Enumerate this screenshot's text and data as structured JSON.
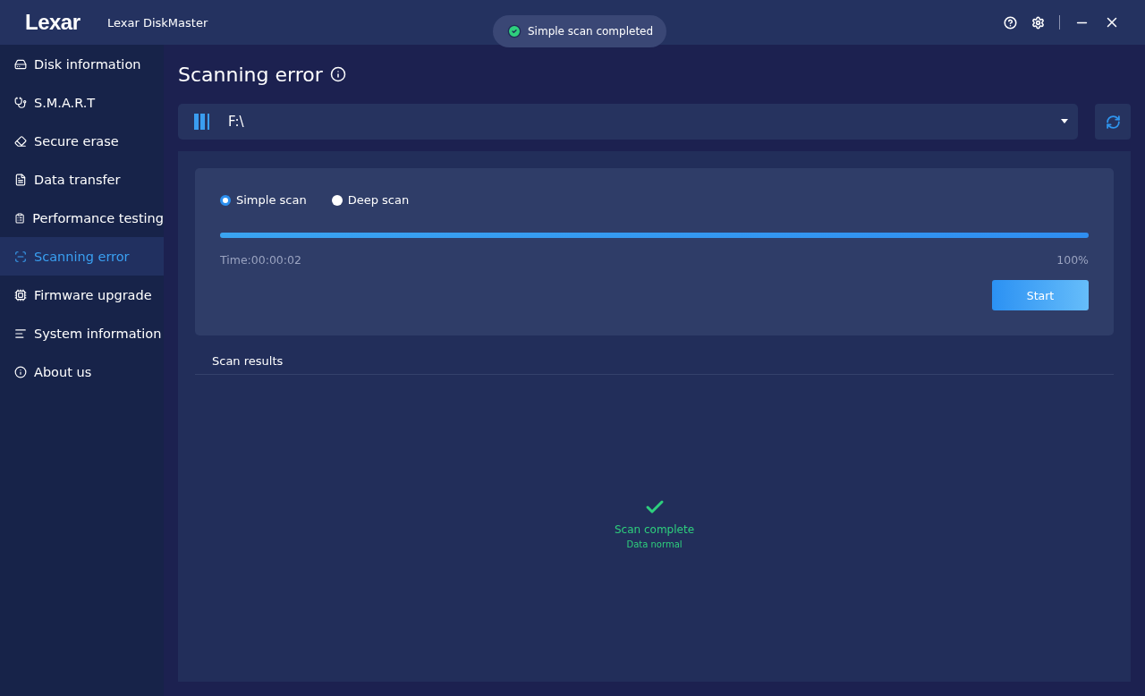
{
  "window": {
    "logo": "Lexar",
    "title": "Lexar DiskMaster"
  },
  "toast": {
    "text": "Simple scan completed"
  },
  "sidebar": {
    "items": [
      {
        "label": "Disk information",
        "selected": false
      },
      {
        "label": "S.M.A.R.T",
        "selected": false
      },
      {
        "label": "Secure erase",
        "selected": false
      },
      {
        "label": "Data transfer",
        "selected": false
      },
      {
        "label": "Performance testing",
        "selected": false
      },
      {
        "label": "Scanning error",
        "selected": true
      },
      {
        "label": "Firmware upgrade",
        "selected": false
      },
      {
        "label": "System information",
        "selected": false
      },
      {
        "label": "About us",
        "selected": false
      }
    ]
  },
  "page_title": "Scanning error",
  "drive_select": {
    "value": "F:\\"
  },
  "scan_modes": [
    {
      "label": "Simple scan",
      "selected": true
    },
    {
      "label": "Deep scan",
      "selected": false
    }
  ],
  "progress": {
    "level": 1,
    "time": "Time:00:00:02",
    "percent": "100%"
  },
  "start_button": "Start",
  "results": {
    "heading": "Scan results",
    "status": "Scan complete",
    "detail": "Data normal"
  }
}
